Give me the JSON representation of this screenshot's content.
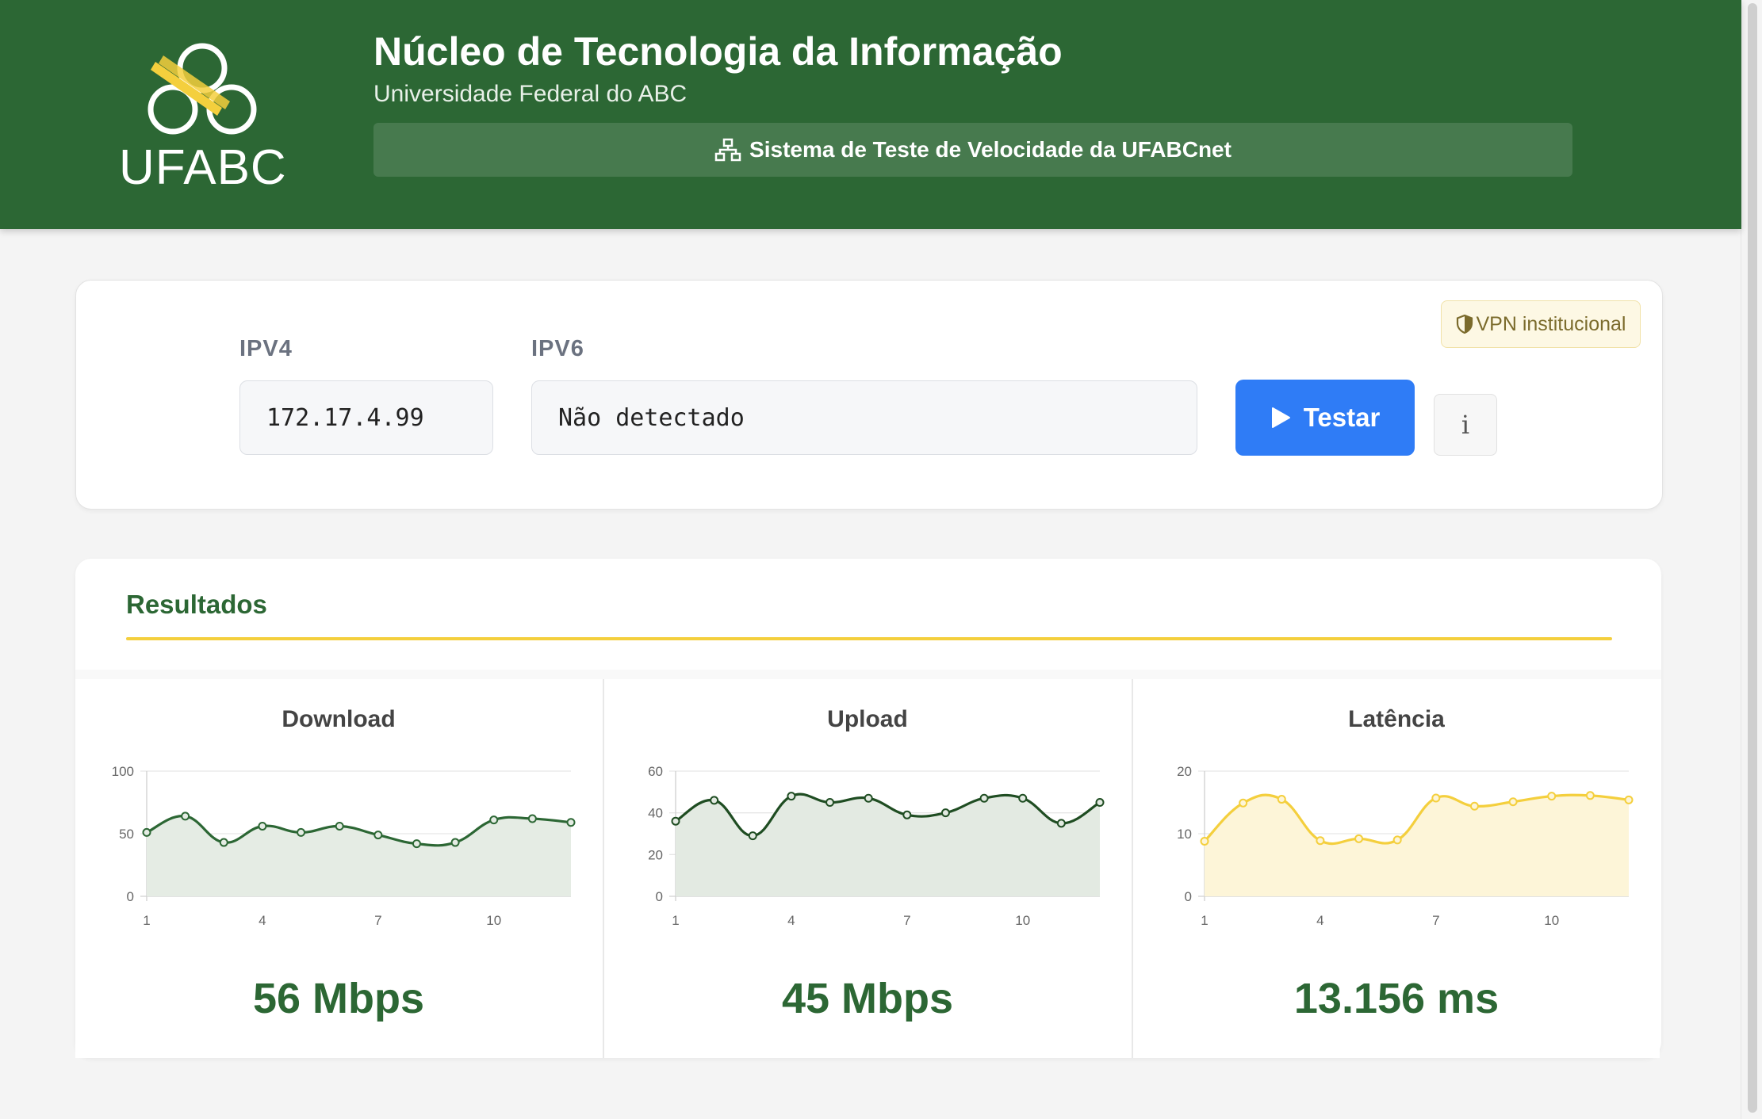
{
  "header": {
    "logo_text": "UFABC",
    "title": "Núcleo de Tecnologia da Informação",
    "subtitle": "Universidade Federal do ABC",
    "banner": "Sistema de Teste de Velocidade da UFABCnet",
    "banner_icon": "network-icon",
    "colors": {
      "primary": "#2c6734",
      "logo_accent": "#f4cf3d"
    }
  },
  "ip_panel": {
    "vpn_badge": "VPN institucional",
    "vpn_icon": "shield-icon",
    "ipv4_label": "IPV4",
    "ipv4_value": "172.17.4.99",
    "ipv6_label": "IPV6",
    "ipv6_value": "Não detectado",
    "test_button": "Testar",
    "info_button": "i",
    "colors": {
      "test_button": "#2f7cf6"
    }
  },
  "results": {
    "title": "Resultados",
    "download": {
      "title": "Download",
      "value": "56 Mbps"
    },
    "upload": {
      "title": "Upload",
      "value": "45 Mbps"
    },
    "latency": {
      "title": "Latência",
      "value": "13.156 ms"
    }
  },
  "chart_data": [
    {
      "type": "area",
      "title": "Download",
      "x": [
        1,
        2,
        3,
        4,
        5,
        6,
        7,
        8,
        9,
        10,
        11,
        12
      ],
      "xticks": [
        1,
        4,
        7,
        10
      ],
      "yticks": [
        0,
        50,
        100
      ],
      "ylim": [
        0,
        100
      ],
      "values": [
        51,
        64,
        43,
        56,
        51,
        56,
        49,
        42,
        43,
        61,
        62,
        59
      ],
      "color": "#2c6734",
      "fill": "#e5ece4",
      "grid": true
    },
    {
      "type": "area",
      "title": "Upload",
      "x": [
        1,
        2,
        3,
        4,
        5,
        6,
        7,
        8,
        9,
        10,
        11,
        12
      ],
      "xticks": [
        1,
        4,
        7,
        10
      ],
      "yticks": [
        0,
        20,
        40,
        60
      ],
      "ylim": [
        0,
        60
      ],
      "values": [
        36,
        46,
        29,
        48,
        45,
        47,
        39,
        40,
        47,
        47,
        35,
        45
      ],
      "color": "#1f4d22",
      "fill": "#e3eae2",
      "grid": true
    },
    {
      "type": "area",
      "title": "Latência",
      "x": [
        1,
        2,
        3,
        4,
        5,
        6,
        7,
        8,
        9,
        10,
        11,
        12
      ],
      "xticks": [
        1,
        4,
        7,
        10
      ],
      "yticks": [
        0,
        10,
        20
      ],
      "ylim": [
        0,
        20
      ],
      "values": [
        8.8,
        14.9,
        15.5,
        8.9,
        9.2,
        9.0,
        15.7,
        14.4,
        15.1,
        16.0,
        16.1,
        15.4
      ],
      "color": "#f4cf3d",
      "fill": "#fdf5d8",
      "grid": true
    }
  ]
}
